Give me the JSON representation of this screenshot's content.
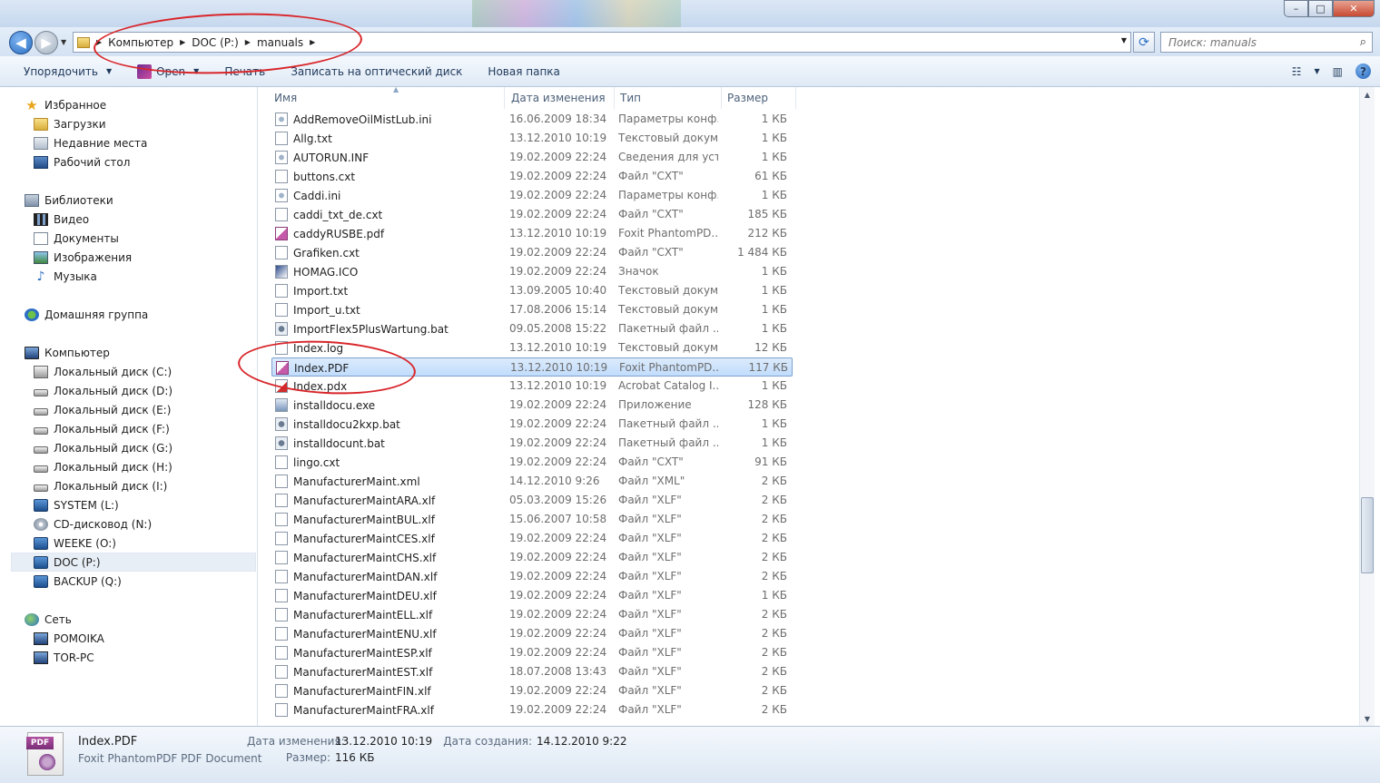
{
  "window": {
    "minimize": "–",
    "maximize": "□",
    "close": "✕"
  },
  "navigation": {
    "back_icon": "arrow-left-icon",
    "forward_icon": "arrow-right-icon",
    "breadcrumb": [
      "Компьютер",
      "DOC (P:)",
      "manuals"
    ],
    "search_placeholder": "Поиск: manuals"
  },
  "toolbar": {
    "organize": "Упорядочить",
    "open": "Open",
    "print": "Печать",
    "burn": "Записать на оптический диск",
    "new_folder": "Новая папка"
  },
  "sidebar": {
    "favorites": {
      "title": "Избранное",
      "items": [
        "Загрузки",
        "Недавние места",
        "Рабочий стол"
      ]
    },
    "libraries": {
      "title": "Библиотеки",
      "items": [
        "Видео",
        "Документы",
        "Изображения",
        "Музыка"
      ]
    },
    "homegroup": "Домашняя группа",
    "computer": {
      "title": "Компьютер",
      "items": [
        "Локальный диск (C:)",
        "Локальный диск (D:)",
        "Локальный диск (E:)",
        "Локальный диск (F:)",
        "Локальный диск (G:)",
        "Локальный диск (H:)",
        "Локальный диск (I:)",
        "SYSTEM (L:)",
        "CD-дисковод (N:)",
        "WEEKE (O:)",
        "DOC (P:)",
        "BACKUP (Q:)"
      ],
      "selected": "DOC (P:)"
    },
    "network": {
      "title": "Сеть",
      "items": [
        "POMOIKA",
        "TOR-PC"
      ]
    }
  },
  "columns": [
    "Имя",
    "Дата изменения",
    "Тип",
    "Размер"
  ],
  "files": [
    {
      "name": "AddRemoveOilMistLub.ini",
      "date": "16.06.2009 18:34",
      "type": "Параметры конф...",
      "size": "1 КБ",
      "icon": "ini"
    },
    {
      "name": "Allg.txt",
      "date": "13.12.2010 10:19",
      "type": "Текстовый докум...",
      "size": "1 КБ",
      "icon": "txt"
    },
    {
      "name": "AUTORUN.INF",
      "date": "19.02.2009 22:24",
      "type": "Сведения для уст...",
      "size": "1 КБ",
      "icon": "ini"
    },
    {
      "name": "buttons.cxt",
      "date": "19.02.2009 22:24",
      "type": "Файл \"CXT\"",
      "size": "61 КБ",
      "icon": "txt"
    },
    {
      "name": "Caddi.ini",
      "date": "19.02.2009 22:24",
      "type": "Параметры конф...",
      "size": "1 КБ",
      "icon": "ini"
    },
    {
      "name": "caddi_txt_de.cxt",
      "date": "19.02.2009 22:24",
      "type": "Файл \"CXT\"",
      "size": "185 КБ",
      "icon": "txt"
    },
    {
      "name": "caddyRUSBE.pdf",
      "date": "13.12.2010 10:19",
      "type": "Foxit PhantomPD...",
      "size": "212 КБ",
      "icon": "pdf"
    },
    {
      "name": "Grafiken.cxt",
      "date": "19.02.2009 22:24",
      "type": "Файл \"CXT\"",
      "size": "1 484 КБ",
      "icon": "txt"
    },
    {
      "name": "HOMAG.ICO",
      "date": "19.02.2009 22:24",
      "type": "Значок",
      "size": "1 КБ",
      "icon": "ico"
    },
    {
      "name": "Import.txt",
      "date": "13.09.2005 10:40",
      "type": "Текстовый докум...",
      "size": "1 КБ",
      "icon": "txt"
    },
    {
      "name": "Import_u.txt",
      "date": "17.08.2006 15:14",
      "type": "Текстовый докум...",
      "size": "1 КБ",
      "icon": "txt"
    },
    {
      "name": "ImportFlex5PlusWartung.bat",
      "date": "09.05.2008 15:22",
      "type": "Пакетный файл ...",
      "size": "1 КБ",
      "icon": "bat"
    },
    {
      "name": "Index.log",
      "date": "13.12.2010 10:19",
      "type": "Текстовый докум...",
      "size": "12 КБ",
      "icon": "txt"
    },
    {
      "name": "Index.PDF",
      "date": "13.12.2010 10:19",
      "type": "Foxit PhantomPD...",
      "size": "117 КБ",
      "icon": "pdf",
      "selected": true
    },
    {
      "name": "Index.pdx",
      "date": "13.12.2010 10:19",
      "type": "Acrobat Catalog I...",
      "size": "1 КБ",
      "icon": "pdx"
    },
    {
      "name": "installdocu.exe",
      "date": "19.02.2009 22:24",
      "type": "Приложение",
      "size": "128 КБ",
      "icon": "exe"
    },
    {
      "name": "installdocu2kxp.bat",
      "date": "19.02.2009 22:24",
      "type": "Пакетный файл ...",
      "size": "1 КБ",
      "icon": "bat"
    },
    {
      "name": "installdocunt.bat",
      "date": "19.02.2009 22:24",
      "type": "Пакетный файл ...",
      "size": "1 КБ",
      "icon": "bat"
    },
    {
      "name": "lingo.cxt",
      "date": "19.02.2009 22:24",
      "type": "Файл \"CXT\"",
      "size": "91 КБ",
      "icon": "txt"
    },
    {
      "name": "ManufacturerMaint.xml",
      "date": "14.12.2010 9:26",
      "type": "Файл \"XML\"",
      "size": "2 КБ",
      "icon": "txt"
    },
    {
      "name": "ManufacturerMaintARA.xlf",
      "date": "05.03.2009 15:26",
      "type": "Файл \"XLF\"",
      "size": "2 КБ",
      "icon": "txt"
    },
    {
      "name": "ManufacturerMaintBUL.xlf",
      "date": "15.06.2007 10:58",
      "type": "Файл \"XLF\"",
      "size": "2 КБ",
      "icon": "txt"
    },
    {
      "name": "ManufacturerMaintCES.xlf",
      "date": "19.02.2009 22:24",
      "type": "Файл \"XLF\"",
      "size": "2 КБ",
      "icon": "txt"
    },
    {
      "name": "ManufacturerMaintCHS.xlf",
      "date": "19.02.2009 22:24",
      "type": "Файл \"XLF\"",
      "size": "2 КБ",
      "icon": "txt"
    },
    {
      "name": "ManufacturerMaintDAN.xlf",
      "date": "19.02.2009 22:24",
      "type": "Файл \"XLF\"",
      "size": "2 КБ",
      "icon": "txt"
    },
    {
      "name": "ManufacturerMaintDEU.xlf",
      "date": "19.02.2009 22:24",
      "type": "Файл \"XLF\"",
      "size": "1 КБ",
      "icon": "txt"
    },
    {
      "name": "ManufacturerMaintELL.xlf",
      "date": "19.02.2009 22:24",
      "type": "Файл \"XLF\"",
      "size": "2 КБ",
      "icon": "txt"
    },
    {
      "name": "ManufacturerMaintENU.xlf",
      "date": "19.02.2009 22:24",
      "type": "Файл \"XLF\"",
      "size": "2 КБ",
      "icon": "txt"
    },
    {
      "name": "ManufacturerMaintESP.xlf",
      "date": "19.02.2009 22:24",
      "type": "Файл \"XLF\"",
      "size": "2 КБ",
      "icon": "txt"
    },
    {
      "name": "ManufacturerMaintEST.xlf",
      "date": "18.07.2008 13:43",
      "type": "Файл \"XLF\"",
      "size": "2 КБ",
      "icon": "txt"
    },
    {
      "name": "ManufacturerMaintFIN.xlf",
      "date": "19.02.2009 22:24",
      "type": "Файл \"XLF\"",
      "size": "2 КБ",
      "icon": "txt"
    },
    {
      "name": "ManufacturerMaintFRA.xlf",
      "date": "19.02.2009 22:24",
      "type": "Файл \"XLF\"",
      "size": "2 КБ",
      "icon": "txt"
    }
  ],
  "details": {
    "icon_text": "PDF",
    "name": "Index.PDF",
    "type": "Foxit PhantomPDF PDF Document",
    "modified_label": "Дата изменения:",
    "modified": "13.12.2010 10:19",
    "created_label": "Дата создания:",
    "created": "14.12.2010 9:22",
    "size_label": "Размер:",
    "size": "116 КБ"
  },
  "colors": {
    "annotation": "#d8262a",
    "selection": "#c1dcfc",
    "link_text": "#1e395b"
  }
}
